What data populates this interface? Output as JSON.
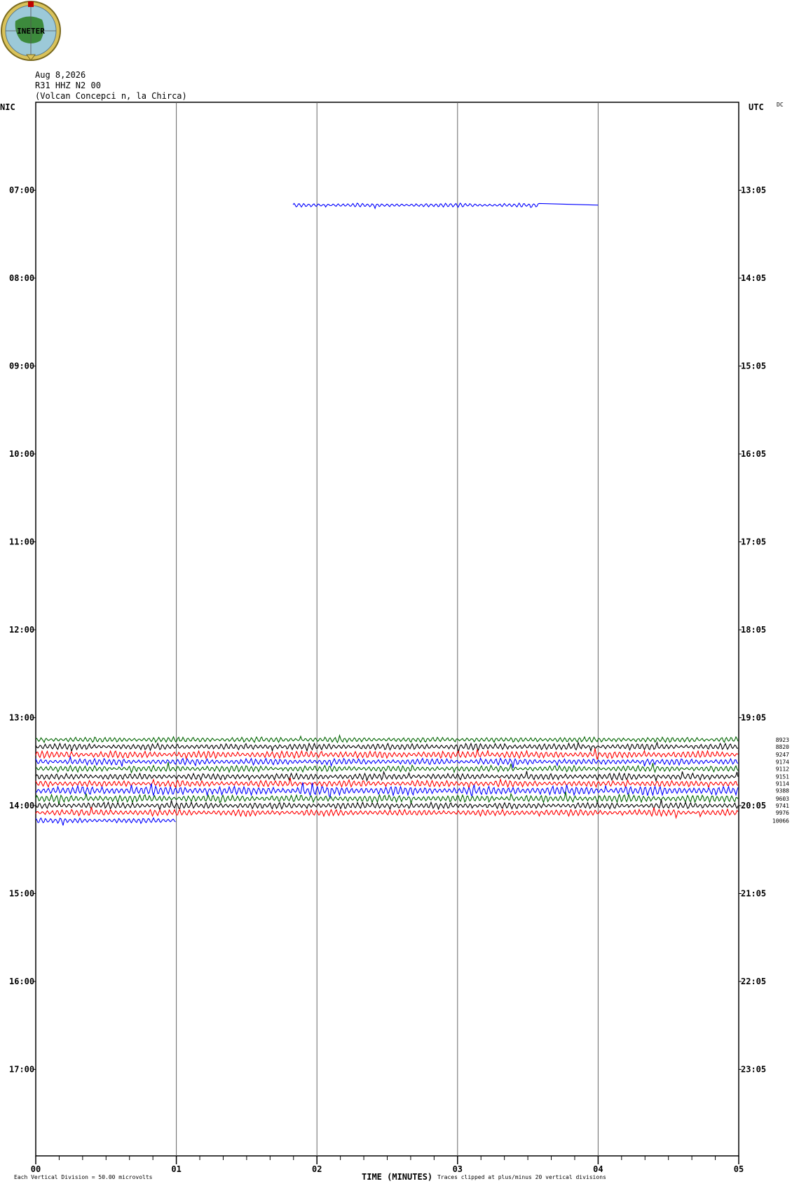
{
  "logo_text": "INETER",
  "header": {
    "date": "Aug 8,2026",
    "station": "R31 HHZ N2 00",
    "location": "(Volcan Concepci  n, la Chirca)"
  },
  "left_tz": "NIC",
  "right_tz": "UTC",
  "dc_label": "DC",
  "footer": {
    "scale": "Each Vertical Division =   50.00 microvolts",
    "xlabel": "TIME (MINUTES)",
    "clip_note": "Traces clipped at plus/minus 20 vertical divisions"
  },
  "chart_data": {
    "type": "line",
    "title": "",
    "xlabel": "TIME (MINUTES)",
    "ylabel": "",
    "xlim": [
      0,
      5
    ],
    "x_ticks": [
      "00",
      "01",
      "02",
      "03",
      "04",
      "05"
    ],
    "left_hour_labels": [
      "07:00",
      "08:00",
      "09:00",
      "10:00",
      "11:00",
      "12:00",
      "13:00",
      "14:00",
      "15:00",
      "16:00",
      "17:00"
    ],
    "right_hour_labels": [
      "13:05",
      "14:05",
      "15:05",
      "16:05",
      "17:05",
      "18:05",
      "19:05",
      "20:05",
      "21:05",
      "22:05",
      "23:05"
    ],
    "grid": true,
    "series": [
      {
        "row_hour": 7.17,
        "x_start": 1.83,
        "x_end": 3.58,
        "flat_to": 4.0,
        "color": "#0000ff",
        "amp": 2.2,
        "label": ""
      },
      {
        "row_hour": 13.25,
        "x_start": 0,
        "x_end": 5,
        "color": "#006400",
        "amp": 3,
        "label": "8923"
      },
      {
        "row_hour": 13.33,
        "x_start": 0,
        "x_end": 5,
        "color": "#000000",
        "amp": 3.5,
        "label": "8820"
      },
      {
        "row_hour": 13.42,
        "x_start": 0,
        "x_end": 5,
        "color": "#ff0000",
        "amp": 4,
        "label": "9247"
      },
      {
        "row_hour": 13.5,
        "x_start": 0,
        "x_end": 5,
        "color": "#0000ff",
        "amp": 3.5,
        "label": "9174"
      },
      {
        "row_hour": 13.58,
        "x_start": 0,
        "x_end": 5,
        "color": "#006400",
        "amp": 3.5,
        "label": "9112"
      },
      {
        "row_hour": 13.67,
        "x_start": 0,
        "x_end": 5,
        "color": "#000000",
        "amp": 3.5,
        "label": "9151"
      },
      {
        "row_hour": 13.75,
        "x_start": 0,
        "x_end": 5,
        "color": "#ff0000",
        "amp": 3.5,
        "label": "9114"
      },
      {
        "row_hour": 13.83,
        "x_start": 0,
        "x_end": 5,
        "color": "#0000ff",
        "amp": 5,
        "label": "9388"
      },
      {
        "row_hour": 13.92,
        "x_start": 0,
        "x_end": 5,
        "color": "#006400",
        "amp": 4,
        "label": "9603"
      },
      {
        "row_hour": 14.0,
        "x_start": 0,
        "x_end": 5,
        "color": "#000000",
        "amp": 3.5,
        "label": "9741"
      },
      {
        "row_hour": 14.08,
        "x_start": 0,
        "x_end": 5,
        "color": "#ff0000",
        "amp": 3.5,
        "label": "9976"
      },
      {
        "row_hour": 14.17,
        "x_start": 0,
        "x_end": 1,
        "color": "#0000ff",
        "amp": 3,
        "label": "10066"
      }
    ]
  }
}
